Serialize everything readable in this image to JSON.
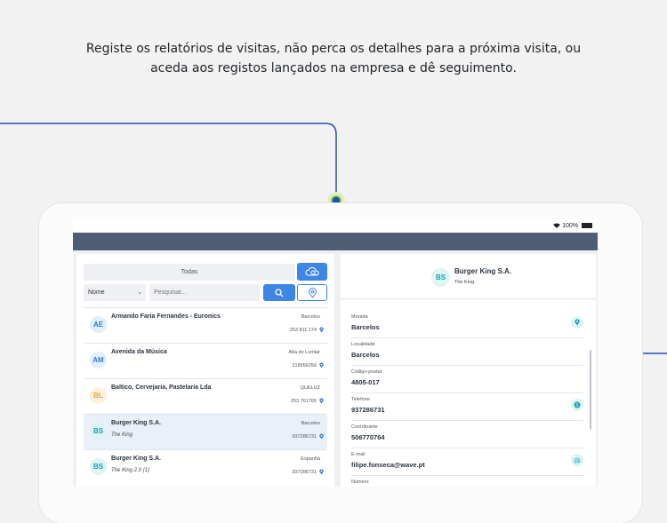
{
  "headline": {
    "line1": "Registe os relatórios de visitas, não perca os detalhes para a próxima visita, ou",
    "line2": "aceda aos registos lançados na empresa e dê seguimento."
  },
  "status_bar": {
    "battery": "100%"
  },
  "filter": {
    "all_label": "Todas"
  },
  "search": {
    "field_selected": "Nome",
    "placeholder": "Pesquisar..."
  },
  "list": [
    {
      "initials": "AE",
      "name": "Armando Faria Fernandes - Euronics",
      "sub": "",
      "location": "Barcelos",
      "phone": "253 811 174",
      "color": "#2b7fd8",
      "bg": "#e3eefb"
    },
    {
      "initials": "AM",
      "name": "Avenida da Música",
      "sub": "",
      "location": "Alta do Lumiar",
      "phone": "218956256",
      "color": "#2b7fd8",
      "bg": "#e3eefb"
    },
    {
      "initials": "BL",
      "name": "Baltico, Cervejaria, Pastelaria Lda",
      "sub": "",
      "location": "QUELUZ",
      "phone": "253 761765",
      "color": "#e8a640",
      "bg": "#fdf1dd"
    },
    {
      "initials": "BS",
      "name": "Burger King S.A.",
      "sub": "The King",
      "location": "Barcelos",
      "phone": "937286731",
      "color": "#13a4a8",
      "bg": "#dff3f4",
      "selected": true
    },
    {
      "initials": "BS",
      "name": "Burger King S.A.",
      "sub": "The King 2.0    (1)",
      "location": "Espanha",
      "phone": "937286731",
      "color": "#13a4a8",
      "bg": "#dff3f4"
    }
  ],
  "detail": {
    "initials": "BS",
    "name": "Burger King S.A.",
    "sub": "The King",
    "fields": [
      {
        "label": "Morada",
        "value": "Barcelos",
        "action": "map-pin-icon"
      },
      {
        "label": "Localidade",
        "value": "Barcelos",
        "action": ""
      },
      {
        "label": "Código-postal",
        "value": "4805-017",
        "action": ""
      },
      {
        "label": "Telefone",
        "value": "937286731",
        "action": "skype-icon"
      },
      {
        "label": "Contribuinte",
        "value": "506770764",
        "action": ""
      },
      {
        "label": "E-mail",
        "value": "filipe.fonseca@wave.pt",
        "action": "at-icon"
      },
      {
        "label": "Número",
        "value": "",
        "action": ""
      }
    ]
  },
  "colors": {
    "accent": "#3d86e5",
    "appbar": "#4e5d73",
    "teal": "#13a4a8",
    "connector": "#1f4fbf"
  }
}
